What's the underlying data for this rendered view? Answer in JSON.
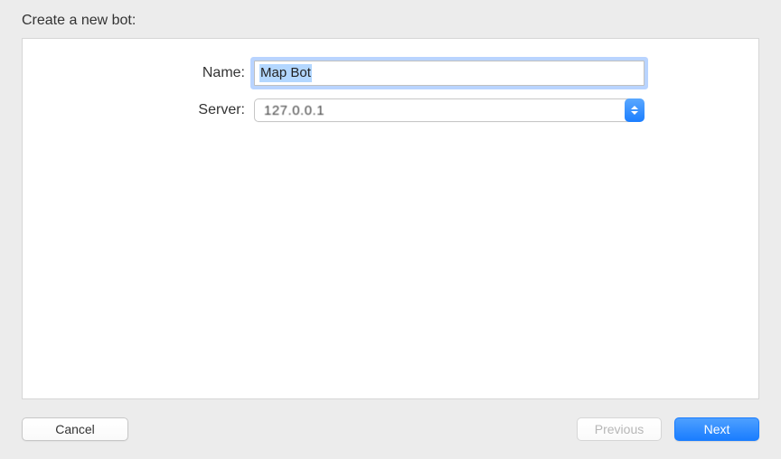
{
  "header": {
    "title": "Create a new bot:"
  },
  "form": {
    "name_label": "Name:",
    "name_value": "Map Bot",
    "server_label": "Server:",
    "server_value": "127.0.0.1"
  },
  "buttons": {
    "cancel": "Cancel",
    "previous": "Previous",
    "next": "Next"
  }
}
